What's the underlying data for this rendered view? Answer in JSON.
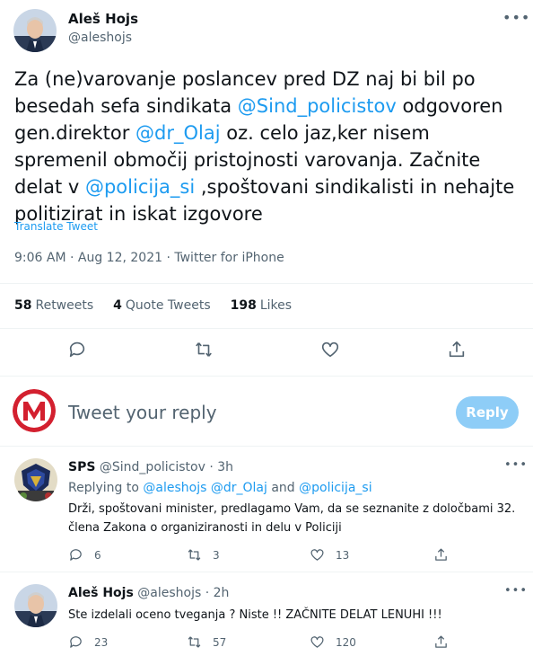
{
  "main_tweet": {
    "author_name": "Aleš Hojs",
    "author_handle": "@aleshojs",
    "text_segments": [
      {
        "text": "Za (ne)varovanje poslancev pred DZ naj bi bil po besedah sefa sindikata ",
        "link": false
      },
      {
        "text": "@Sind_policistov",
        "link": true
      },
      {
        "text": " odgovoren gen.direktor ",
        "link": false
      },
      {
        "text": "@dr_Olaj",
        "link": true
      },
      {
        "text": " oz. celo jaz,ker nisem spremenil območij pristojnosti varovanja. Začnite delat v ",
        "link": false
      },
      {
        "text": "@policija_si",
        "link": true
      },
      {
        "text": " ,spoštovani sindikalisti in nehajte politizirat in iskat izgovore",
        "link": false
      }
    ],
    "translate_label": "Translate Tweet",
    "timestamp": "9:06 AM · Aug 12, 2021 · Twitter for iPhone",
    "stats": {
      "retweets_count": "58",
      "retweets_label": "Retweets",
      "quotes_count": "4",
      "quotes_label": "Quote Tweets",
      "likes_count": "198",
      "likes_label": "Likes"
    }
  },
  "composer": {
    "placeholder": "Tweet your reply",
    "reply_button": "Reply",
    "avatar_letter": "M"
  },
  "replies": [
    {
      "name": "SPS",
      "handle": "@Sind_policistov",
      "time": "· 3h",
      "replying_prefix": "Replying to ",
      "replying_users": [
        "@aleshojs",
        "@dr_Olaj",
        "@policija_si"
      ],
      "replying_and": " and ",
      "text": "Drži, spoštovani minister, predlagamo Vam, da se seznanite z določbami 32. člena Zakona o organiziranosti in delu v Policiji",
      "reply_count": "6",
      "retweet_count": "3",
      "like_count": "13"
    },
    {
      "name": "Aleš Hojs",
      "handle": "@aleshojs",
      "time": "· 2h",
      "text": "Ste izdelali oceno tveganja ? Niste !! ZAČNITE DELAT LENUHI !!!",
      "reply_count": "23",
      "retweet_count": "57",
      "like_count": "120"
    }
  ],
  "colors": {
    "accent": "#1d9bf0",
    "muted": "#536471",
    "reply_button_disabled": "#8ecdf7",
    "logo_red": "#d3202f"
  }
}
